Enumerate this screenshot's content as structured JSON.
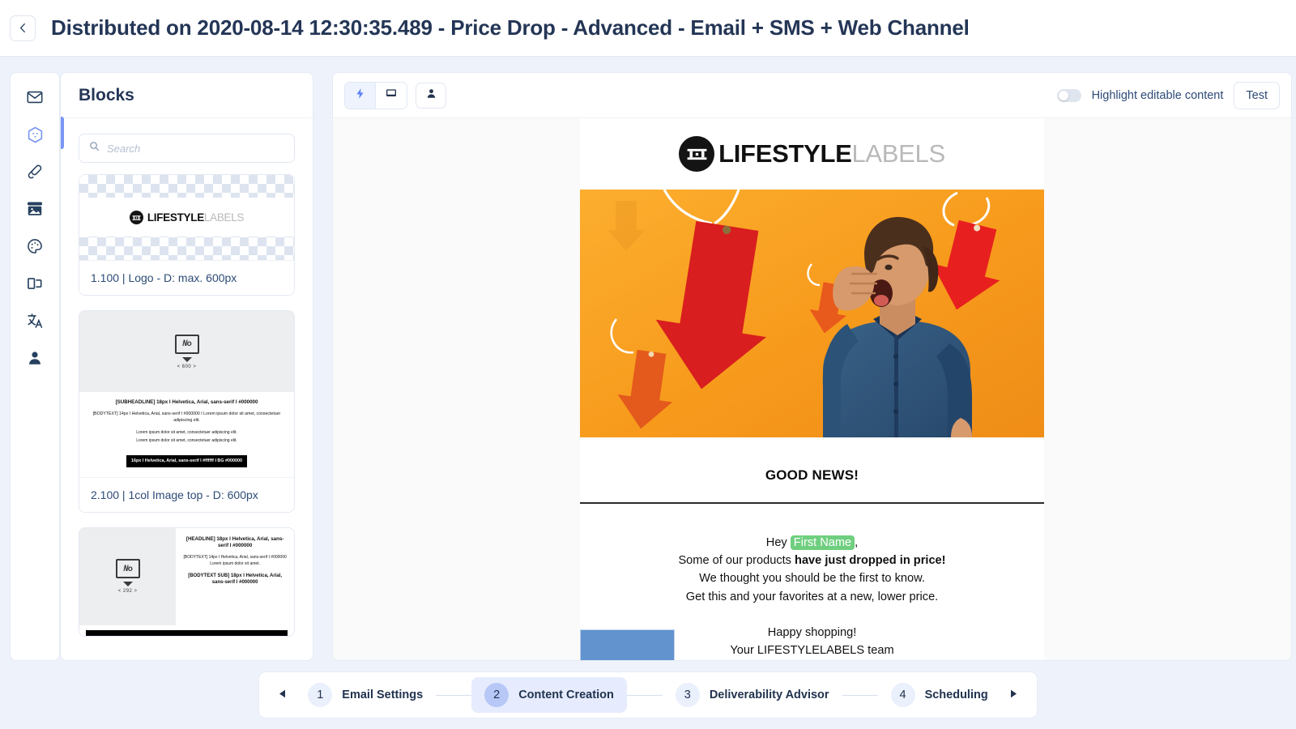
{
  "header": {
    "back_icon": "chevron-left-icon",
    "title": "Distributed on 2020-08-14 12:30:35.489 - Price Drop - Advanced - Email + SMS + Web Channel"
  },
  "rail": {
    "items": [
      {
        "icon": "mail-icon",
        "name": "email",
        "active": false
      },
      {
        "icon": "blocks-hexagon-icon",
        "name": "blocks",
        "active": true
      },
      {
        "icon": "link-icon",
        "name": "links",
        "active": false
      },
      {
        "icon": "image-library-icon",
        "name": "images",
        "active": false
      },
      {
        "icon": "palette-icon",
        "name": "styles",
        "active": false
      },
      {
        "icon": "layers-icon",
        "name": "layers",
        "active": false
      },
      {
        "icon": "translate-icon",
        "name": "translation",
        "active": false
      },
      {
        "icon": "person-icon",
        "name": "personalization",
        "active": false
      }
    ]
  },
  "blocks_panel": {
    "title": "Blocks",
    "search": {
      "value": "",
      "placeholder": "Search",
      "icon": "search-icon"
    },
    "cards": [
      {
        "label": "1.100 | Logo - D: max. 600px",
        "preview_type": "logo",
        "logo": {
          "mark": "LL",
          "bold_part": "LIFESTYLE",
          "light_part": "LABELS"
        }
      },
      {
        "label": "2.100 | 1col Image top - D: 600px",
        "preview_type": "image-top",
        "placeholder_caption": "< 600 >",
        "subheadline": "[SUBHEADLINE] 18px I Helvetica, Arial, sans-serif I #000000",
        "bodytext": "[BODYTEXT] 14px I Helvetica, Arial, sans-serif I #000000 I Lorem ipsum dolor sit amet, consectetuer adipiscing elit.",
        "lorem_lines": [
          "Lorem ipsum dolor sit amet, consectetuer adipiscing elit.",
          "Lorem ipsum dolor sit amet, consectetuer adipiscing elit."
        ],
        "button_text": "16px I Helvetica, Arial, sans-serif I #ffffff I BG #000000"
      },
      {
        "label": "",
        "preview_type": "image-left",
        "placeholder_caption": "< 292 >",
        "headline": "[HEADLINE] 18px I Helvetica, Arial, sans-serif I #000000",
        "bodytext": "[BODYTEXT] 14px I Helvetica, Arial, sans-serif I #000000 Lorem ipsum dolor sit amet.",
        "bodytext_sub": "[BODYTEXT SUB] 18px I Helvetica, Arial, sans-serif I #000000"
      }
    ]
  },
  "editor_toolbar": {
    "segments": [
      {
        "icon": "lightning-bolt-icon",
        "name": "interactive-mode",
        "active": true
      },
      {
        "icon": "desktop-icon",
        "name": "desktop-preview",
        "active": false
      }
    ],
    "person_button": {
      "icon": "person-icon",
      "name": "recipient-preview"
    },
    "highlight_toggle": {
      "label": "Highlight editable content",
      "on": false
    },
    "test_button": "Test"
  },
  "email_preview": {
    "logo": {
      "mark": "LL",
      "bold_part": "LIFESTYLE",
      "light_part": "LABELS"
    },
    "hero": {
      "alt": "man-shouting-with-price-tag-arrows",
      "bg_color": "#f79a1c",
      "tag_red": "#e01f1f",
      "tag_orange": "#e8591c",
      "shirt_color": "#2d5277"
    },
    "headline": "GOOD NEWS!",
    "greeting_prefix": "Hey ",
    "greeting_token": "First Name",
    "greeting_suffix": ",",
    "line2_prefix": "Some of our products ",
    "line2_bold": "have just dropped in price!",
    "line3": "We thought you should be the first to know.",
    "line4": "Get this and your favorites at a new, lower price.",
    "line5": "Happy shopping!",
    "line6": "Your LIFESTYLELABELS team"
  },
  "stepper": {
    "prev_icon": "triangle-left-icon",
    "next_icon": "triangle-right-icon",
    "steps": [
      {
        "num": "1",
        "label": "Email Settings",
        "active": false
      },
      {
        "num": "2",
        "label": "Content Creation",
        "active": true
      },
      {
        "num": "3",
        "label": "Deliverability Advisor",
        "active": false
      },
      {
        "num": "4",
        "label": "Scheduling",
        "active": false
      }
    ]
  },
  "colors": {
    "accent": "#5b81f2",
    "title": "#243656",
    "token_green": "#6fcf7f",
    "hero_orange": "#f79a1c"
  }
}
